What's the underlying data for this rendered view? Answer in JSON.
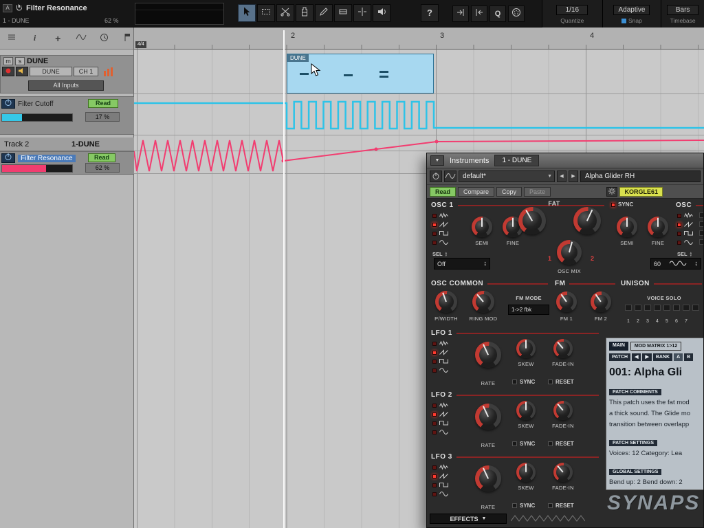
{
  "colors": {
    "accent_cyan": "#2ec3e8",
    "accent_pink": "#f23d70",
    "clip_blue": "#a7d8f0",
    "read_green": "#86c964",
    "snap_blue": "#3b8fd4",
    "knob_red": "#c23a32",
    "device_yellow": "#d9e14e"
  },
  "toolbar": {
    "param_title": "Filter Resonance",
    "param_track": "1 - DUNE",
    "param_value": "62 %",
    "help_label": "?",
    "quantize_label_q": "Q",
    "quantize_value": "1/16",
    "quantize_label": "Quantize",
    "snap_value": "Adaptive",
    "snap_label": "Snap",
    "timebase_value": "Bars",
    "timebase_label": "Timebase"
  },
  "inspector": {
    "mute": "m",
    "solo": "s",
    "track_name": "DUNE",
    "out_name": "DUNE",
    "channel": "CH 1",
    "all_inputs": "All Inputs",
    "cutoff_name": "Filter Cutoff",
    "cutoff_read": "Read",
    "cutoff_value": "17 %",
    "track2_name": "Track 2",
    "track2_preset": "1-DUNE",
    "res_name": "Filter Resonance",
    "res_read": "Read",
    "res_value": "62 %"
  },
  "ruler": {
    "timesig": "4/4",
    "bar2": "2",
    "bar3": "3",
    "bar4": "4"
  },
  "clip": {
    "label": "DUNE"
  },
  "plugin": {
    "menu_label": "Instruments",
    "tab": "1 - DUNE",
    "preset": "default*",
    "patch_display": "Alpha Glider RH",
    "read": "Read",
    "compare": "Compare",
    "copy": "Copy",
    "paste": "Paste",
    "device": "KORGLE61",
    "osc1": {
      "title": "OSC 1",
      "sel": "SEL",
      "semi": "SEMI",
      "fine": "FINE",
      "fat": "FAT",
      "one": "1",
      "two": "2",
      "mix": "OSC MIX",
      "mode": "Off",
      "sync": "SYNC"
    },
    "osc2": {
      "title": "OSC",
      "sel": "SEL",
      "semi": "SEMI",
      "fine": "FINE",
      "value": "60"
    },
    "common": {
      "title": "OSC COMMON",
      "pwidth": "P/WIDTH",
      "ringmod": "RING MOD",
      "fm_mode": "FM MODE",
      "fm_mode_value": "1->2 fbk",
      "fm1": "FM 1",
      "fm2": "FM 2",
      "fm_title": "FM"
    },
    "unison": {
      "title": "UNISON",
      "voice_solo": "VOICE SOLO",
      "numbers": [
        "1",
        "2",
        "3",
        "4",
        "5",
        "6",
        "7"
      ]
    },
    "lfo1": {
      "title": "LFO 1",
      "rate": "RATE",
      "skew": "SKEW",
      "sync": "SYNC",
      "fadein": "FADE-IN",
      "reset": "RESET"
    },
    "lfo2": {
      "title": "LFO 2",
      "rate": "RATE",
      "skew": "SKEW",
      "sync": "SYNC",
      "fadein": "FADE-IN",
      "reset": "RESET"
    },
    "lfo3": {
      "title": "LFO 3",
      "rate": "RATE",
      "skew": "SKEW",
      "sync": "SYNC",
      "fadein": "FADE-IN",
      "reset": "RESET"
    },
    "effects": "EFFECTS",
    "display": {
      "tab_main": "MAIN",
      "tab_matrix": "MOD MATRIX 1>12",
      "patch_btn": "PATCH",
      "bank_btn": "BANK",
      "bank_a": "A",
      "bank_b": "B",
      "patch_name": "001: Alpha Gli",
      "comments_title": "PATCH COMMENTS",
      "comment1": "This patch uses the fat mod",
      "comment2": "a thick sound. The Glide mo",
      "comment3": "transition between overlapp",
      "settings_title": "PATCH SETTINGS",
      "settings_line": "Voices: 12   Category: Lea",
      "global_title": "GLOBAL SETTINGS",
      "global_line": "Bend up: 2   Bend down: 2",
      "logo": "SYNAPS"
    }
  },
  "icons": {
    "pointer": "arrow-cursor",
    "range": "dashed-rect",
    "split": "scissors",
    "glue": "glue-tube",
    "draw": "pencil",
    "comp": "rect-tool",
    "separate": "split-tool",
    "audition": "speaker",
    "autoscroll": "arrow-bar",
    "midi": "din-plug",
    "hand": "hand",
    "menu": "hamburger",
    "info": "i",
    "add": "+",
    "curve": "wave",
    "tempo": "clock",
    "marker": "flag",
    "power": "power-symbol",
    "gear": "⚙",
    "dropdown": "▼"
  }
}
